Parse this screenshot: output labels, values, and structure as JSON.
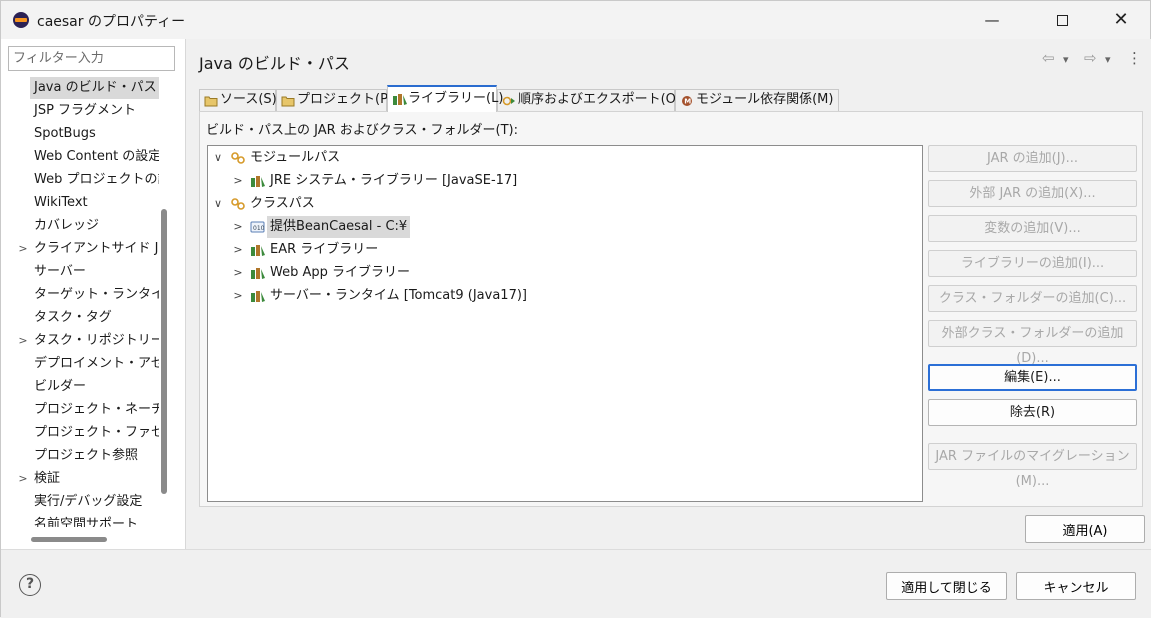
{
  "window": {
    "title": "caesar のプロパティー",
    "min_glyph": "—",
    "close_glyph": "✕"
  },
  "filter": {
    "placeholder": "フィルター入力"
  },
  "nav": {
    "items": [
      {
        "label": "Java のビルド・パス",
        "twisty": "",
        "selected": true
      },
      {
        "label": "JSP フラグメント",
        "twisty": ""
      },
      {
        "label": "SpotBugs",
        "twisty": ""
      },
      {
        "label": "Web Content の設定",
        "twisty": ""
      },
      {
        "label": "Web プロジェクトの設定",
        "twisty": ""
      },
      {
        "label": "WikiText",
        "twisty": ""
      },
      {
        "label": "カバレッジ",
        "twisty": ""
      },
      {
        "label": "クライアントサイド JavaScript",
        "twisty": ">"
      },
      {
        "label": "サーバー",
        "twisty": ""
      },
      {
        "label": "ターゲット・ランタイム",
        "twisty": ""
      },
      {
        "label": "タスク・タグ",
        "twisty": ""
      },
      {
        "label": "タスク・リポジトリー",
        "twisty": ">"
      },
      {
        "label": "デプロイメント・アセンブリー",
        "twisty": ""
      },
      {
        "label": "ビルダー",
        "twisty": ""
      },
      {
        "label": "プロジェクト・ネーチャー",
        "twisty": ""
      },
      {
        "label": "プロジェクト・ファセット",
        "twisty": ""
      },
      {
        "label": "プロジェクト参照",
        "twisty": ""
      },
      {
        "label": "検証",
        "twisty": ">"
      },
      {
        "label": "実行/デバッグ設定",
        "twisty": ""
      },
      {
        "label": "名前空間サポート",
        "twisty": ""
      }
    ]
  },
  "page": {
    "title": "Java のビルド・パス",
    "nav_icons": {
      "back": "⇦",
      "forward": "⇨",
      "dropdown": "▾",
      "menu": "⋮"
    }
  },
  "tabs": [
    {
      "label": "ソース(S)",
      "icon": "source-folder-icon"
    },
    {
      "label": "プロジェクト(P)",
      "icon": "project-icon"
    },
    {
      "label": "ライブラリー(L)",
      "icon": "library-icon",
      "active": true
    },
    {
      "label": "順序およびエクスポート(O)",
      "icon": "order-export-icon"
    },
    {
      "label": "モジュール依存関係(M)",
      "icon": "module-dependency-icon"
    }
  ],
  "panel": {
    "label": "ビルド・パス上の JAR およびクラス・フォルダー(T):",
    "tree": [
      {
        "label": "モジュールパス",
        "twisty": "∨",
        "icon": "module-path-icon",
        "level": 0
      },
      {
        "label": "JRE システム・ライブラリー [JavaSE-17]",
        "twisty": ">",
        "icon": "library-icon",
        "level": 1
      },
      {
        "label": "クラスパス",
        "twisty": "∨",
        "icon": "classpath-icon",
        "level": 0
      },
      {
        "label": "提供BeanCaesal - C:¥",
        "twisty": ">",
        "icon": "class-folder-icon",
        "level": 1,
        "selected": true
      },
      {
        "label": "EAR ライブラリー",
        "twisty": ">",
        "icon": "library-icon",
        "level": 1
      },
      {
        "label": "Web App ライブラリー",
        "twisty": ">",
        "icon": "library-icon",
        "level": 1
      },
      {
        "label": "サーバー・ランタイム [Tomcat9 (Java17)]",
        "twisty": ">",
        "icon": "library-icon",
        "level": 1
      }
    ]
  },
  "buttons": [
    {
      "label": "JAR の追加(J)...",
      "enabled": false
    },
    {
      "label": "外部 JAR の追加(X)...",
      "enabled": false
    },
    {
      "label": "変数の追加(V)...",
      "enabled": false
    },
    {
      "label": "ライブラリーの追加(I)...",
      "enabled": false
    },
    {
      "label": "クラス・フォルダーの追加(C)...",
      "enabled": false
    },
    {
      "label": "外部クラス・フォルダーの追加(D)...",
      "enabled": false
    },
    {
      "label": "編集(E)...",
      "enabled": true,
      "focused": true
    },
    {
      "label": "除去(R)",
      "enabled": true
    },
    {
      "label": "JAR ファイルのマイグレーション(M)...",
      "enabled": false
    }
  ],
  "apply_label": "適用(A)",
  "footer": {
    "help_glyph": "?",
    "apply_close_label": "適用して閉じる",
    "cancel_label": "キャンセル"
  },
  "colors": {
    "accent": "#2a6ccf",
    "selection": "#d9d9d9",
    "library_icon_green": "#3c8a3c",
    "library_icon_brown": "#b0762a",
    "module_icon_orange": "#d69a2a"
  }
}
